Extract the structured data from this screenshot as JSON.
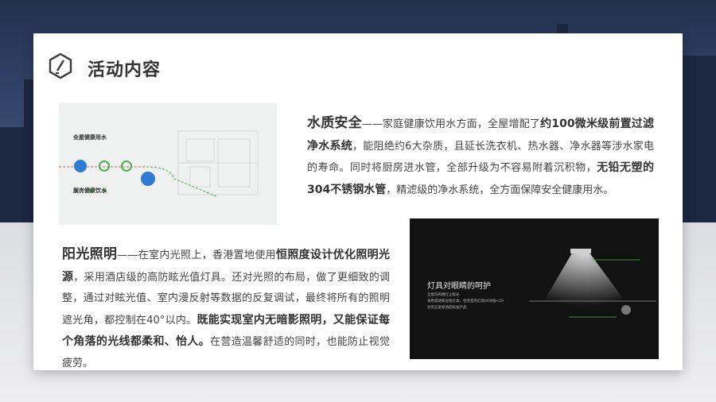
{
  "header": {
    "title": "活动内容",
    "icon": "pencil-hexagon-icon"
  },
  "section_water": {
    "heading": "水质安全",
    "t1": "——家庭健康饮用水方面，全屋增配了",
    "b1": "约100微米级前置过滤净水系统",
    "t2": "，能阻绝约6大杂质，且延长洗衣机、热水器、净水器等涉水家电的寿命。同时将厨房进水管，全部升级为不容易附着沉积物，",
    "b2": "无铅无塑的304不锈钢水管",
    "t3": "，精滤级的净水系统，全方面保障安全健康用水。"
  },
  "section_light": {
    "heading": "阳光照明",
    "t1": "——在室内光照上，香港置地使用",
    "b1": "恒照度设计优化照明光源",
    "t2": "，采用酒店级的高防眩光值灯具。还对光照的布局，做了更细致的调整，通过对眩光值、室内漫反射等数据的反复调试，最终将所有的照明遮光角，都控制在40°以内。",
    "b2": "既能实现室内无暗影照明，又能保证每个角落的光线都柔和、怡人。",
    "t3": "在营造温馨舒适的同时，也能防止视觉疲劳。"
  },
  "photo_water": {
    "label1": "全屋健康用水",
    "label2": "厨房健康饮水"
  },
  "photo_lamp": {
    "title": "灯具对眼睛的呵护",
    "line1": "全屋均布精灯止眩光",
    "line2": "采用高防眩光值灯具，住宅室内灯具UGR值<10",
    "line3": "达到五星级酒店标准产品"
  },
  "colors": {
    "accent_green": "#4caf50",
    "accent_blue": "#2e7bd6",
    "text_dark": "#333333"
  }
}
